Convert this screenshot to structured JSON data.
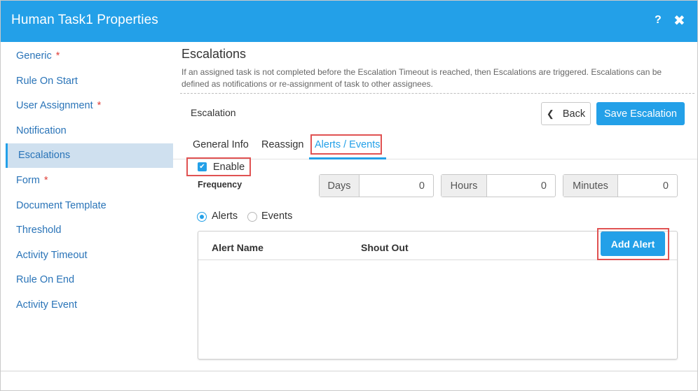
{
  "titlebar": {
    "title": "Human Task1 Properties",
    "help_glyph": "?",
    "close_glyph": "✖",
    "color": "#23a0e8"
  },
  "sidebar": {
    "required_mark": "*",
    "items": [
      {
        "label": "Generic",
        "required": true
      },
      {
        "label": "Rule On Start",
        "required": false
      },
      {
        "label": "User Assignment",
        "required": true
      },
      {
        "label": "Notification",
        "required": false
      },
      {
        "label": "Escalations",
        "required": false,
        "active": true
      },
      {
        "label": "Form",
        "required": true
      },
      {
        "label": "Document Template",
        "required": false
      },
      {
        "label": "Threshold",
        "required": false
      },
      {
        "label": "Activity Timeout",
        "required": false
      },
      {
        "label": "Rule On End",
        "required": false
      },
      {
        "label": "Activity Event",
        "required": false
      }
    ]
  },
  "main": {
    "heading": "Escalations",
    "description": "If an assigned task is not completed before the Escalation Timeout is reached, then Escalations are triggered. Escalations can be defined as notifications or re-assignment of task to other assignees.",
    "escalation_label": "Escalation",
    "back_label": "Back",
    "back_icon": "chevron-left",
    "save_label": "Save Escalation"
  },
  "tabs": [
    {
      "label": "General Info",
      "active": false
    },
    {
      "label": "Reassign",
      "active": false
    },
    {
      "label": "Alerts / Events",
      "active": true
    }
  ],
  "enable": {
    "label": "Enable",
    "checked": true,
    "check_glyph": "✔"
  },
  "frequency": {
    "label": "Frequency",
    "days": {
      "label": "Days",
      "value": "0"
    },
    "hours": {
      "label": "Hours",
      "value": "0"
    },
    "minutes": {
      "label": "Minutes",
      "value": "0"
    }
  },
  "mode": {
    "alerts_label": "Alerts",
    "events_label": "Events",
    "selected": "Alerts"
  },
  "alerts_table": {
    "columns": [
      "Alert Name",
      "Shout Out"
    ],
    "rows": [],
    "add_label": "Add Alert"
  },
  "colors": {
    "accent": "#23a0e8",
    "highlight": "#e05252",
    "sidebar_active_bg": "#cfe0ef",
    "link": "#2a74b8",
    "required": "#e0413a"
  }
}
